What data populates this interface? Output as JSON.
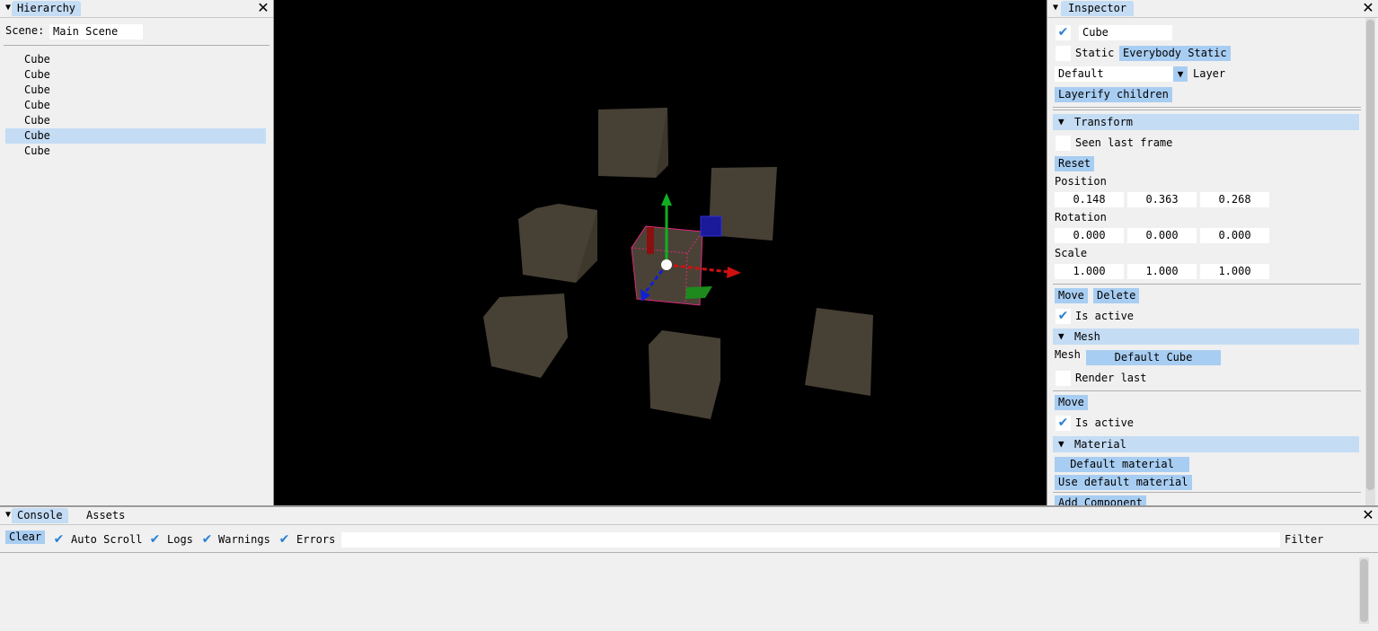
{
  "hierarchy": {
    "tab": "Hierarchy",
    "scene_label": "Scene:",
    "scene_value": "Main Scene",
    "items": [
      {
        "label": "Cube",
        "selected": false
      },
      {
        "label": "Cube",
        "selected": false
      },
      {
        "label": "Cube",
        "selected": false
      },
      {
        "label": "Cube",
        "selected": false
      },
      {
        "label": "Cube",
        "selected": false
      },
      {
        "label": "Cube",
        "selected": true
      },
      {
        "label": "Cube",
        "selected": false
      }
    ]
  },
  "inspector": {
    "tab": "Inspector",
    "object_name": "Cube",
    "enabled": true,
    "static_label": "Static",
    "static_checked": false,
    "everybody_static": "Everybody Static",
    "layer_value": "Default",
    "layer_label": "Layer",
    "layerify_children": "Layerify children",
    "transform": {
      "header": "Transform",
      "seen_last_frame": "Seen last frame",
      "reset": "Reset",
      "position_label": "Position",
      "position": [
        "0.148",
        "0.363",
        "0.268"
      ],
      "rotation_label": "Rotation",
      "rotation": [
        "0.000",
        "0.000",
        "0.000"
      ],
      "scale_label": "Scale",
      "scale": [
        "1.000",
        "1.000",
        "1.000"
      ],
      "move": "Move",
      "delete": "Delete",
      "is_active": "Is active"
    },
    "mesh": {
      "header": "Mesh",
      "mesh_label": "Mesh",
      "mesh_value": "Default Cube",
      "render_last": "Render last",
      "move": "Move",
      "is_active": "Is active"
    },
    "material": {
      "header": "Material",
      "default_material": "Default material",
      "use_default_material": "Use default material"
    },
    "add_component": "Add Component"
  },
  "console": {
    "tabs": [
      "Console",
      "Assets"
    ],
    "clear": "Clear",
    "auto_scroll": "Auto Scroll",
    "logs": "Logs",
    "warnings": "Warnings",
    "errors": "Errors",
    "filter_label": "Filter",
    "filter_value": ""
  },
  "icons": {
    "collapse": "triangle-down-icon",
    "close": "close-icon",
    "check": "checkmark-icon",
    "dropdown": "dropdown-arrow-icon"
  },
  "colors": {
    "panel_bg": "#f0f0f0",
    "button": "#a8cdf2",
    "header": "#c4dcf4",
    "checkmark": "#2a7fd4",
    "viewport_bg": "#000000",
    "cube": "#4a4236",
    "selection_outline": "#e0287c",
    "gizmo_x": "#d01010",
    "gizmo_y": "#10b020",
    "gizmo_z": "#1020d0"
  },
  "viewport": {
    "name": "scene-view"
  }
}
